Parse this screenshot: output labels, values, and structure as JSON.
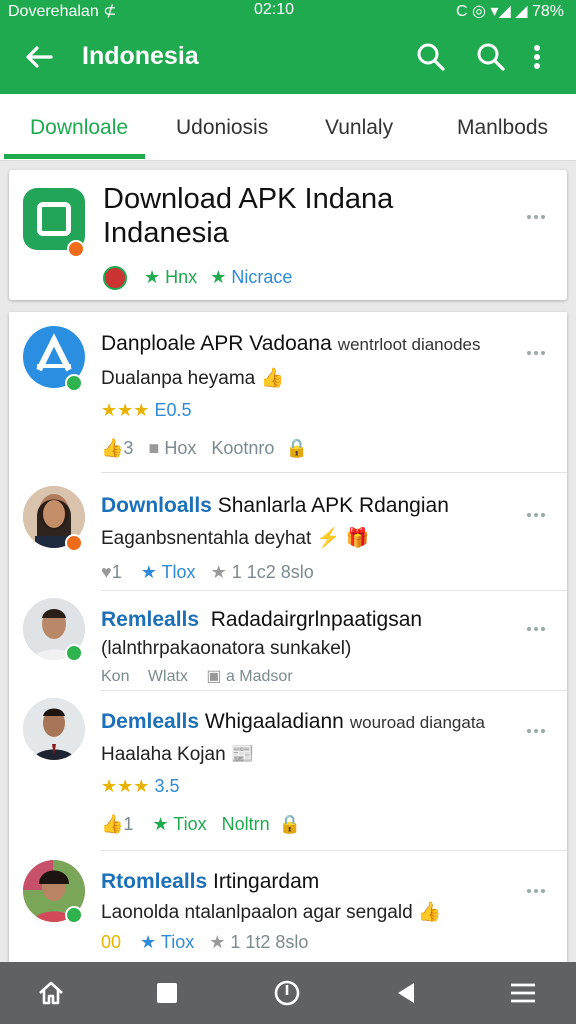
{
  "status_bar": {
    "left": "Doverehalan ⊄",
    "time": "02:10",
    "right": "C ◎ ▾◢ ◢ 78%"
  },
  "app_bar": {
    "title": "Indonesia"
  },
  "tabs": [
    "Downloale",
    "Udoniosis",
    "Vunlaly",
    "Manlbods"
  ],
  "featured": {
    "title": "Download APK Indana Indanesia",
    "meta_a": "Hnx",
    "meta_b": "Nicrace"
  },
  "rows": [
    {
      "title": "Danploale APR Vadoana",
      "side": "wentrloot dianodes",
      "sub": "Dualanpa heyama 👍",
      "rating": "★★★",
      "rating_text": "E0.5",
      "m1": "3",
      "m2": "Hox",
      "m3": "Kootnro"
    },
    {
      "title_blue": "Downloalls",
      "title": "Shanlarla APK Rdangian",
      "sub": "Eaganbsnentahla deyhat ⚡ 🎁",
      "m1": "1",
      "m2": "Tlox",
      "m3": "1 1c2 8slo"
    },
    {
      "title_blue": "Remlealls",
      "title": "Radadairgrlnpaatigsan",
      "sub": "(lalnthrpakaonatora sunkakel)",
      "m1": "Kon",
      "m2": "Wlatx",
      "m3": "a Madsor"
    },
    {
      "title_blue": "Demlealls",
      "title": "Whigaaladiann",
      "side": "wouroad diangata",
      "sub": "Haalaha Kojan 📰",
      "rating": "★★★",
      "rating_text": "3.5",
      "m1": "1",
      "m2": "Tiox",
      "m3": "Noltrn"
    },
    {
      "title_blue": "Rtomlealls",
      "title": "Irtingardam",
      "sub": "Laonolda ntalanlpaalon agar sengald 👍",
      "m1": "00",
      "m2": "Tiox",
      "m3": "1 1t2 8slo"
    }
  ],
  "colors": {
    "brand": "#1faa4f",
    "link": "#1c70b8",
    "navbar": "#5f6163"
  }
}
